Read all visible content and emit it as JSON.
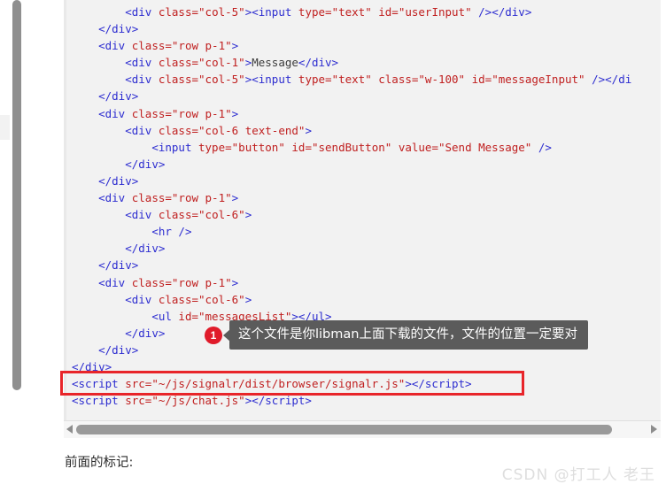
{
  "code_block": {
    "language": "html",
    "lines": [
      [
        {
          "t": "        ",
          "c": "txt"
        },
        {
          "t": "<div ",
          "c": "tag"
        },
        {
          "t": "class=",
          "c": "attr"
        },
        {
          "t": "\"col-5\"",
          "c": "val"
        },
        {
          "t": ">",
          "c": "tag"
        },
        {
          "t": "<input ",
          "c": "tag"
        },
        {
          "t": "type=",
          "c": "attr"
        },
        {
          "t": "\"text\"",
          "c": "val"
        },
        {
          "t": " ",
          "c": "txt"
        },
        {
          "t": "id=",
          "c": "attr"
        },
        {
          "t": "\"userInput\"",
          "c": "val"
        },
        {
          "t": " />",
          "c": "tag"
        },
        {
          "t": "</div>",
          "c": "tag"
        }
      ],
      [
        {
          "t": "    ",
          "c": "txt"
        },
        {
          "t": "</div>",
          "c": "tag"
        }
      ],
      [
        {
          "t": "    ",
          "c": "txt"
        },
        {
          "t": "<div ",
          "c": "tag"
        },
        {
          "t": "class=",
          "c": "attr"
        },
        {
          "t": "\"row p-1\"",
          "c": "val"
        },
        {
          "t": ">",
          "c": "tag"
        }
      ],
      [
        {
          "t": "        ",
          "c": "txt"
        },
        {
          "t": "<div ",
          "c": "tag"
        },
        {
          "t": "class=",
          "c": "attr"
        },
        {
          "t": "\"col-1\"",
          "c": "val"
        },
        {
          "t": ">",
          "c": "tag"
        },
        {
          "t": "Message",
          "c": "txt"
        },
        {
          "t": "</div>",
          "c": "tag"
        }
      ],
      [
        {
          "t": "        ",
          "c": "txt"
        },
        {
          "t": "<div ",
          "c": "tag"
        },
        {
          "t": "class=",
          "c": "attr"
        },
        {
          "t": "\"col-5\"",
          "c": "val"
        },
        {
          "t": ">",
          "c": "tag"
        },
        {
          "t": "<input ",
          "c": "tag"
        },
        {
          "t": "type=",
          "c": "attr"
        },
        {
          "t": "\"text\"",
          "c": "val"
        },
        {
          "t": " ",
          "c": "txt"
        },
        {
          "t": "class=",
          "c": "attr"
        },
        {
          "t": "\"w-100\"",
          "c": "val"
        },
        {
          "t": " ",
          "c": "txt"
        },
        {
          "t": "id=",
          "c": "attr"
        },
        {
          "t": "\"messageInput\"",
          "c": "val"
        },
        {
          "t": " />",
          "c": "tag"
        },
        {
          "t": "</di",
          "c": "tag"
        }
      ],
      [
        {
          "t": "    ",
          "c": "txt"
        },
        {
          "t": "</div>",
          "c": "tag"
        }
      ],
      [
        {
          "t": "    ",
          "c": "txt"
        },
        {
          "t": "<div ",
          "c": "tag"
        },
        {
          "t": "class=",
          "c": "attr"
        },
        {
          "t": "\"row p-1\"",
          "c": "val"
        },
        {
          "t": ">",
          "c": "tag"
        }
      ],
      [
        {
          "t": "        ",
          "c": "txt"
        },
        {
          "t": "<div ",
          "c": "tag"
        },
        {
          "t": "class=",
          "c": "attr"
        },
        {
          "t": "\"col-6 text-end\"",
          "c": "val"
        },
        {
          "t": ">",
          "c": "tag"
        }
      ],
      [
        {
          "t": "            ",
          "c": "txt"
        },
        {
          "t": "<input ",
          "c": "tag"
        },
        {
          "t": "type=",
          "c": "attr"
        },
        {
          "t": "\"button\"",
          "c": "val"
        },
        {
          "t": " ",
          "c": "txt"
        },
        {
          "t": "id=",
          "c": "attr"
        },
        {
          "t": "\"sendButton\"",
          "c": "val"
        },
        {
          "t": " ",
          "c": "txt"
        },
        {
          "t": "value=",
          "c": "attr"
        },
        {
          "t": "\"Send Message\"",
          "c": "val"
        },
        {
          "t": " />",
          "c": "tag"
        }
      ],
      [
        {
          "t": "        ",
          "c": "txt"
        },
        {
          "t": "</div>",
          "c": "tag"
        }
      ],
      [
        {
          "t": "    ",
          "c": "txt"
        },
        {
          "t": "</div>",
          "c": "tag"
        }
      ],
      [
        {
          "t": "    ",
          "c": "txt"
        },
        {
          "t": "<div ",
          "c": "tag"
        },
        {
          "t": "class=",
          "c": "attr"
        },
        {
          "t": "\"row p-1\"",
          "c": "val"
        },
        {
          "t": ">",
          "c": "tag"
        }
      ],
      [
        {
          "t": "        ",
          "c": "txt"
        },
        {
          "t": "<div ",
          "c": "tag"
        },
        {
          "t": "class=",
          "c": "attr"
        },
        {
          "t": "\"col-6\"",
          "c": "val"
        },
        {
          "t": ">",
          "c": "tag"
        }
      ],
      [
        {
          "t": "            ",
          "c": "txt"
        },
        {
          "t": "<hr />",
          "c": "tag"
        }
      ],
      [
        {
          "t": "        ",
          "c": "txt"
        },
        {
          "t": "</div>",
          "c": "tag"
        }
      ],
      [
        {
          "t": "    ",
          "c": "txt"
        },
        {
          "t": "</div>",
          "c": "tag"
        }
      ],
      [
        {
          "t": "    ",
          "c": "txt"
        },
        {
          "t": "<div ",
          "c": "tag"
        },
        {
          "t": "class=",
          "c": "attr"
        },
        {
          "t": "\"row p-1\"",
          "c": "val"
        },
        {
          "t": ">",
          "c": "tag"
        }
      ],
      [
        {
          "t": "        ",
          "c": "txt"
        },
        {
          "t": "<div ",
          "c": "tag"
        },
        {
          "t": "class=",
          "c": "attr"
        },
        {
          "t": "\"col-6\"",
          "c": "val"
        },
        {
          "t": ">",
          "c": "tag"
        }
      ],
      [
        {
          "t": "            ",
          "c": "txt"
        },
        {
          "t": "<ul ",
          "c": "tag"
        },
        {
          "t": "id=",
          "c": "attr"
        },
        {
          "t": "\"messagesList\"",
          "c": "val"
        },
        {
          "t": ">",
          "c": "tag"
        },
        {
          "t": "</ul>",
          "c": "tag"
        }
      ],
      [
        {
          "t": "        ",
          "c": "txt"
        },
        {
          "t": "</div>",
          "c": "tag"
        }
      ],
      [
        {
          "t": "    ",
          "c": "txt"
        },
        {
          "t": "</div>",
          "c": "tag"
        }
      ],
      [
        {
          "t": "</div>",
          "c": "tag"
        }
      ],
      [
        {
          "t": "<script ",
          "c": "tag"
        },
        {
          "t": "src=",
          "c": "attr"
        },
        {
          "t": "\"~/js/signalr/dist/browser/signalr.js\"",
          "c": "val"
        },
        {
          "t": ">",
          "c": "tag"
        },
        {
          "t": "</script>",
          "c": "tag"
        }
      ],
      [
        {
          "t": "<script ",
          "c": "tag"
        },
        {
          "t": "src=",
          "c": "attr"
        },
        {
          "t": "\"~/js/chat.js\"",
          "c": "val"
        },
        {
          "t": ">",
          "c": "tag"
        },
        {
          "t": "</script>",
          "c": "tag"
        }
      ]
    ]
  },
  "callout": {
    "badge_number": "1",
    "message": "这个文件是你libman上面下载的文件，文件的位置一定要对",
    "badge_color": "#e01b2a",
    "bubble_color": "#5b5b5b"
  },
  "highlight": {
    "color": "#e8252a",
    "target_line": "<script src=\"~/js/signalr/dist/browser/signalr.js\"></script>"
  },
  "below_text": "前面的标记:",
  "watermark": "CSDN @打工人 老王",
  "scrollbars": {
    "vertical_thumb_color": "#8f8f8f",
    "horizontal_thumb_color": "#9a9a9a",
    "left_arrow_glyph": "◀",
    "right_arrow_glyph": "▶"
  }
}
